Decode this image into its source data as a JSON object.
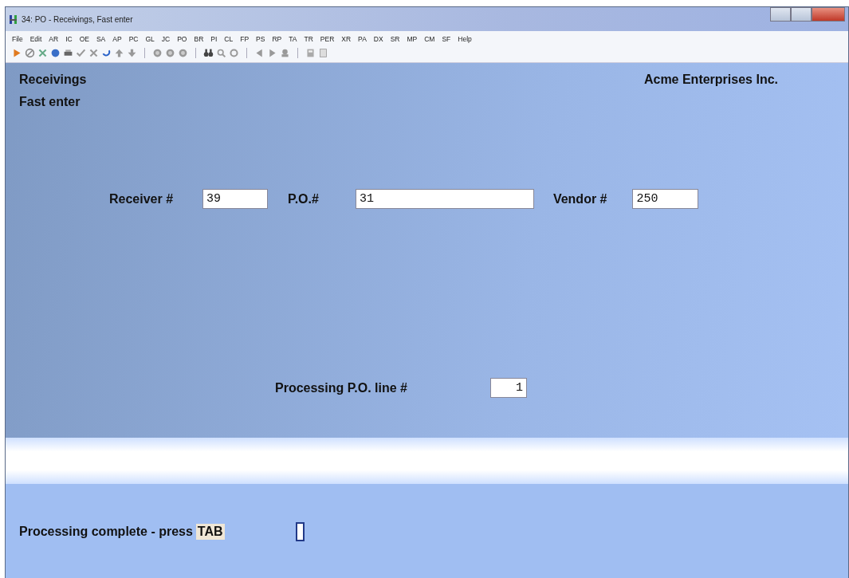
{
  "window": {
    "title": "34: PO - Receivings, Fast enter"
  },
  "menu": [
    "File",
    "Edit",
    "AR",
    "IC",
    "OE",
    "SA",
    "AP",
    "PC",
    "GL",
    "JC",
    "PO",
    "BR",
    "PI",
    "CL",
    "FP",
    "PS",
    "RP",
    "TA",
    "TR",
    "PER",
    "XR",
    "PA",
    "DX",
    "SR",
    "MP",
    "CM",
    "SF",
    "Help"
  ],
  "header": {
    "screen_title": "Receivings",
    "company": "Acme Enterprises Inc.",
    "mode": "Fast enter"
  },
  "fields": [
    {
      "label": "Receiver #",
      "value": "39"
    },
    {
      "label": "P.O.#",
      "value": "31"
    },
    {
      "label": "Vendor #",
      "value": "250"
    }
  ],
  "line": {
    "label": "Processing P.O. line #",
    "value": "1"
  },
  "prompt": {
    "text": "Processing complete - press",
    "key": "TAB"
  }
}
